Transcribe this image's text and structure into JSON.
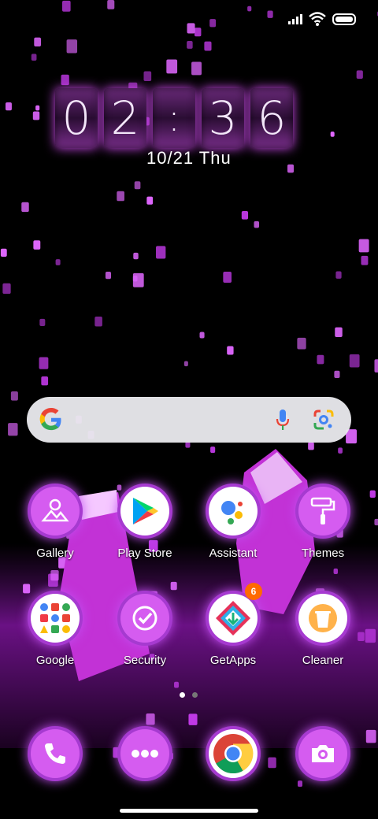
{
  "colors": {
    "accent": "#c24ff0",
    "ring": "#a63ad0",
    "badge": "#ff6a00"
  },
  "status_bar": {
    "icons": [
      "signal-icon",
      "wifi-icon",
      "battery-icon"
    ]
  },
  "clock": {
    "digits": [
      "0",
      "2",
      ":",
      "3",
      "6"
    ]
  },
  "date": {
    "day": "10/21",
    "weekday": "Thu"
  },
  "search": {
    "icons": [
      "google-logo-icon",
      "microphone-icon",
      "google-lens-icon"
    ]
  },
  "apps": [
    {
      "label": "Gallery",
      "icon": "gallery-icon"
    },
    {
      "label": "Play Store",
      "icon": "play-store-icon"
    },
    {
      "label": "Assistant",
      "icon": "assistant-icon"
    },
    {
      "label": "Themes",
      "icon": "themes-icon"
    },
    {
      "label": "Google",
      "icon": "google-folder-icon"
    },
    {
      "label": "Security",
      "icon": "security-icon"
    },
    {
      "label": "GetApps",
      "icon": "getapps-icon",
      "badge": "6"
    },
    {
      "label": "Cleaner",
      "icon": "cleaner-icon"
    }
  ],
  "dock": [
    {
      "icon": "phone-icon"
    },
    {
      "icon": "messaging-icon"
    },
    {
      "icon": "chrome-icon"
    },
    {
      "icon": "camera-icon"
    }
  ],
  "pages": {
    "count": 2,
    "current": 1
  }
}
